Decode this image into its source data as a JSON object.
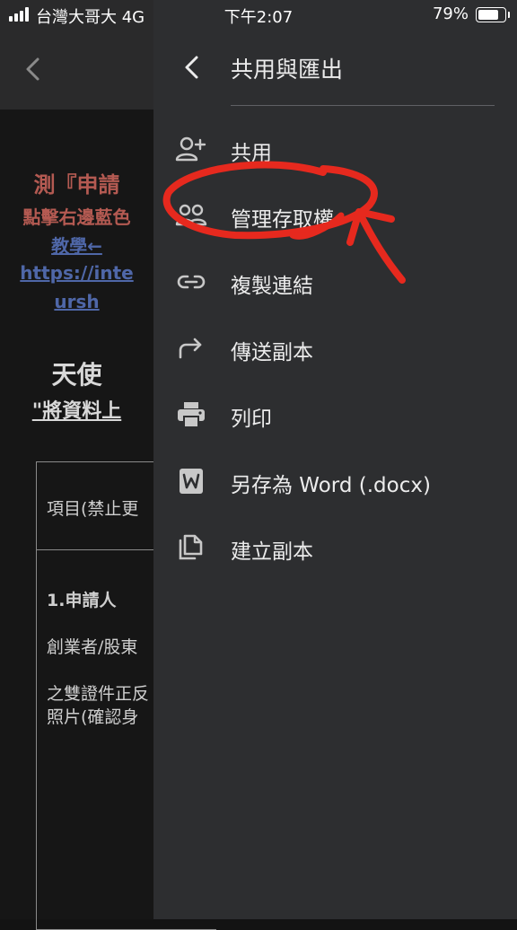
{
  "status_bar": {
    "carrier": "台灣大哥大  4G",
    "time": "下午2:07",
    "battery": "79%"
  },
  "document": {
    "line1": "測『申請",
    "line2": "點擊右邊藍色",
    "line3": "教學←",
    "line4": "https://inte",
    "line5": "ursh",
    "line6": "天使",
    "line7": "\"將資料上",
    "table": {
      "header_cell": "項目(禁止更",
      "row1_title": "1.申請人",
      "row1_line1": "創業者/股東",
      "row1_line2": "之雙證件正反",
      "row1_line3": "照片(確認身"
    }
  },
  "drawer": {
    "title": "共用與匯出",
    "items": [
      {
        "label": "共用",
        "icon": "person-add-icon"
      },
      {
        "label": "管理存取權",
        "icon": "people-icon"
      },
      {
        "label": "複製連結",
        "icon": "link-icon"
      },
      {
        "label": "傳送副本",
        "icon": "forward-icon"
      },
      {
        "label": "列印",
        "icon": "print-icon"
      },
      {
        "label": "另存為 Word (.docx)",
        "icon": "word-icon"
      },
      {
        "label": "建立副本",
        "icon": "copy-icon"
      }
    ]
  },
  "colors": {
    "annotation": "#e6291e",
    "drawer_bg": "#2d2e30"
  }
}
